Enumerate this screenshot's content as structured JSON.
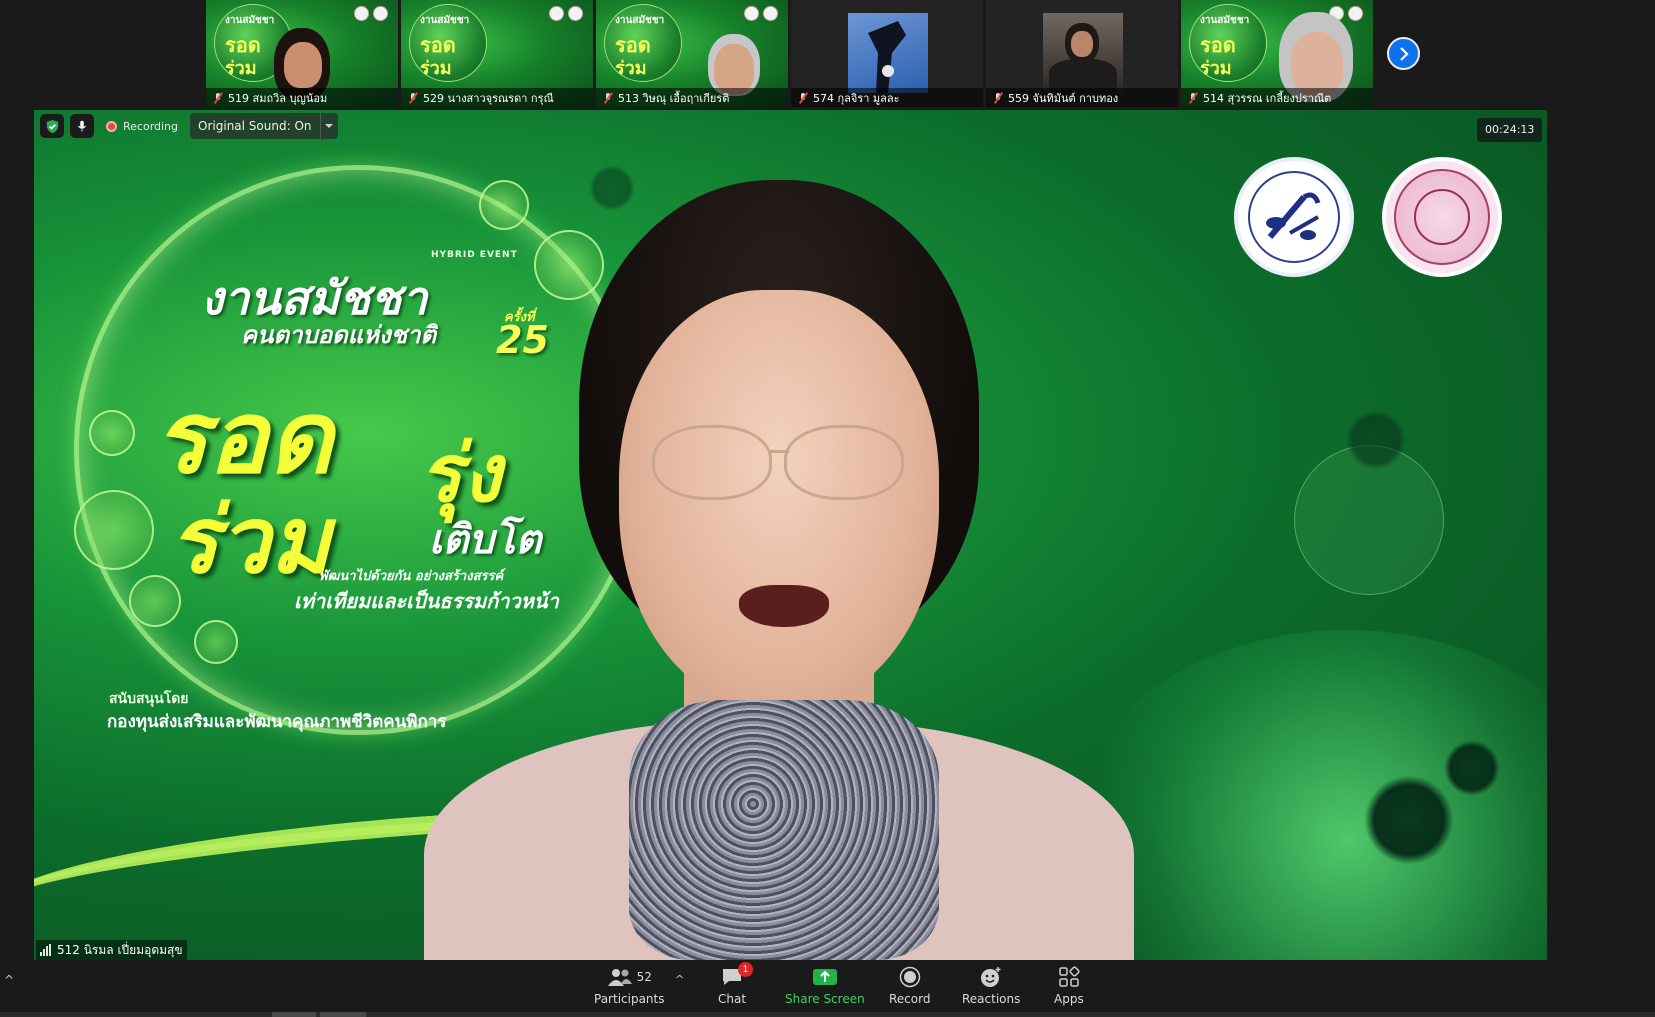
{
  "thumbnails": [
    {
      "name": "519 สมถวิล บุญน้อม",
      "type": "poster"
    },
    {
      "name": "529 นางสาวจุรณรดา กรุณี",
      "type": "poster"
    },
    {
      "name": "513 วิษณุ เอื้อฤาเกียรติ",
      "type": "poster"
    },
    {
      "name": "574 กุลจิรา มูลละ",
      "type": "video"
    },
    {
      "name": "559 จันทิมันต์ กาบทอง",
      "type": "video"
    },
    {
      "name": "514 สุวรรณ เกลี้ยงปราณีต",
      "type": "poster"
    }
  ],
  "thumb_poster_text": {
    "a": "งานสมัชชา",
    "b": "รอด",
    "c": "ร่วม"
  },
  "main": {
    "recording_label": "Recording",
    "original_sound": "Original Sound: On",
    "timer": "00:24:13",
    "speaker_name": "512  นิรมล  เปี่ยมอุดมสุข"
  },
  "poster": {
    "hybrid_event": "HYBRID EVENT",
    "title": "งานสมัชชา",
    "subtitle": "คนตาบอดแห่งชาติ",
    "number_label": "ครั้งที่",
    "number": "25",
    "big_word_1": "รอด",
    "big_word_2": "รุ่ง",
    "big_word_3": "ร่วม",
    "grow_word": "เติบโต",
    "tagline_1": "พัฒนาไปด้วยกัน อย่างสร้างสรรค์",
    "tagline_2": "เท่าเทียมและเป็นธรรมก้าวหน้า",
    "supported_by": "สนับสนุนโดย",
    "fund_name": "กองทุนส่งเสริมและพัฒนาคุณภาพชีวิตคนพิการ"
  },
  "toolbar": {
    "participants_label": "Participants",
    "participants_count": "52",
    "chat_label": "Chat",
    "chat_badge": "1",
    "share_label": "Share Screen",
    "record_label": "Record",
    "reactions_label": "Reactions",
    "apps_label": "Apps"
  },
  "colors": {
    "accent_blue": "#0e72ed",
    "share_green": "#3fd25c",
    "record_red": "#e84a3b",
    "poster_yellow": "#f4ff3a",
    "poster_green": "#18943a"
  }
}
